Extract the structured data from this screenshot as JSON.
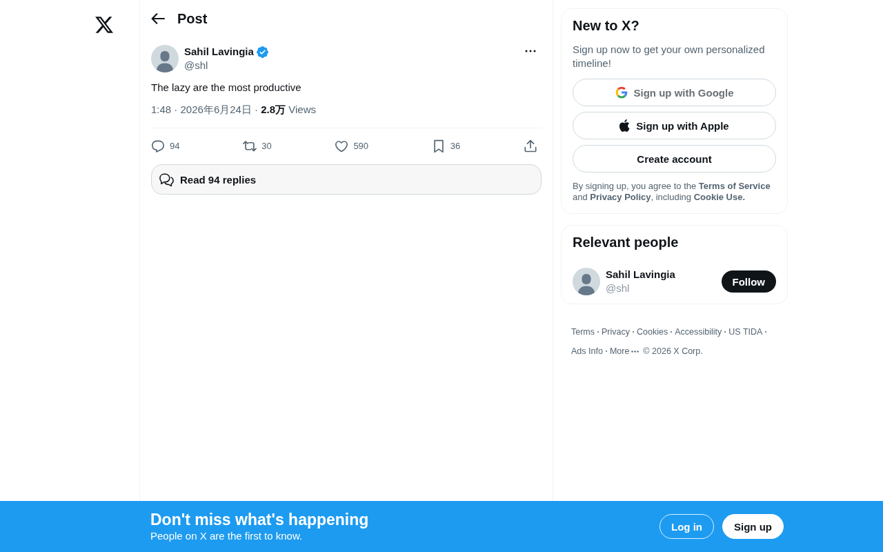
{
  "header": {
    "title": "Post"
  },
  "post": {
    "author": {
      "name": "Sahil Lavingia",
      "handle": "@shl",
      "verified": true
    },
    "text": "The lazy are the most productive",
    "meta": "1:48 · 2026年6月24日 · **2.8万** Views",
    "actions": [
      {
        "kind": "reply",
        "count": "94"
      },
      {
        "kind": "repost",
        "count": "30"
      },
      {
        "kind": "like",
        "count": "590"
      },
      {
        "kind": "bookmark",
        "count": "36"
      },
      {
        "kind": "share"
      }
    ],
    "read_replies": "Read 94 replies"
  },
  "signup_card": {
    "title": "New to X?",
    "subtitle": "Sign up now to get your own personalized timeline!",
    "buttons": [
      {
        "kind": "google",
        "label": "Sign up with Google"
      },
      {
        "kind": "apple",
        "label": "Sign up with Apple"
      },
      {
        "kind": "plain",
        "label": "Create account"
      }
    ],
    "legal": [
      {
        "kind": "text",
        "text": "By signing up, you agree to the "
      },
      {
        "kind": "link",
        "text": "Terms of Service"
      },
      {
        "kind": "text",
        "text": " and "
      },
      {
        "kind": "link",
        "text": "Privacy Policy"
      },
      {
        "kind": "text",
        "text": ", including "
      },
      {
        "kind": "link",
        "text": "Cookie Use."
      }
    ]
  },
  "relevant_people": {
    "title": "Relevant people",
    "people": [
      {
        "name": "Sahil Lavingia",
        "handle": "@shl",
        "button": "Follow"
      }
    ]
  },
  "footer": {
    "links": [
      "Terms",
      "Privacy",
      "Cookies",
      "Accessibility",
      "US TIDA",
      "Ads Info"
    ],
    "more": "More",
    "copyright": "© 2026 X Corp."
  },
  "banner": {
    "title": "Don't miss what's happening",
    "subtitle": "People on X are the first to know.",
    "buttons": [
      {
        "kind": "outline",
        "label": "Log in"
      },
      {
        "kind": "filled",
        "label": "Sign up"
      }
    ]
  }
}
